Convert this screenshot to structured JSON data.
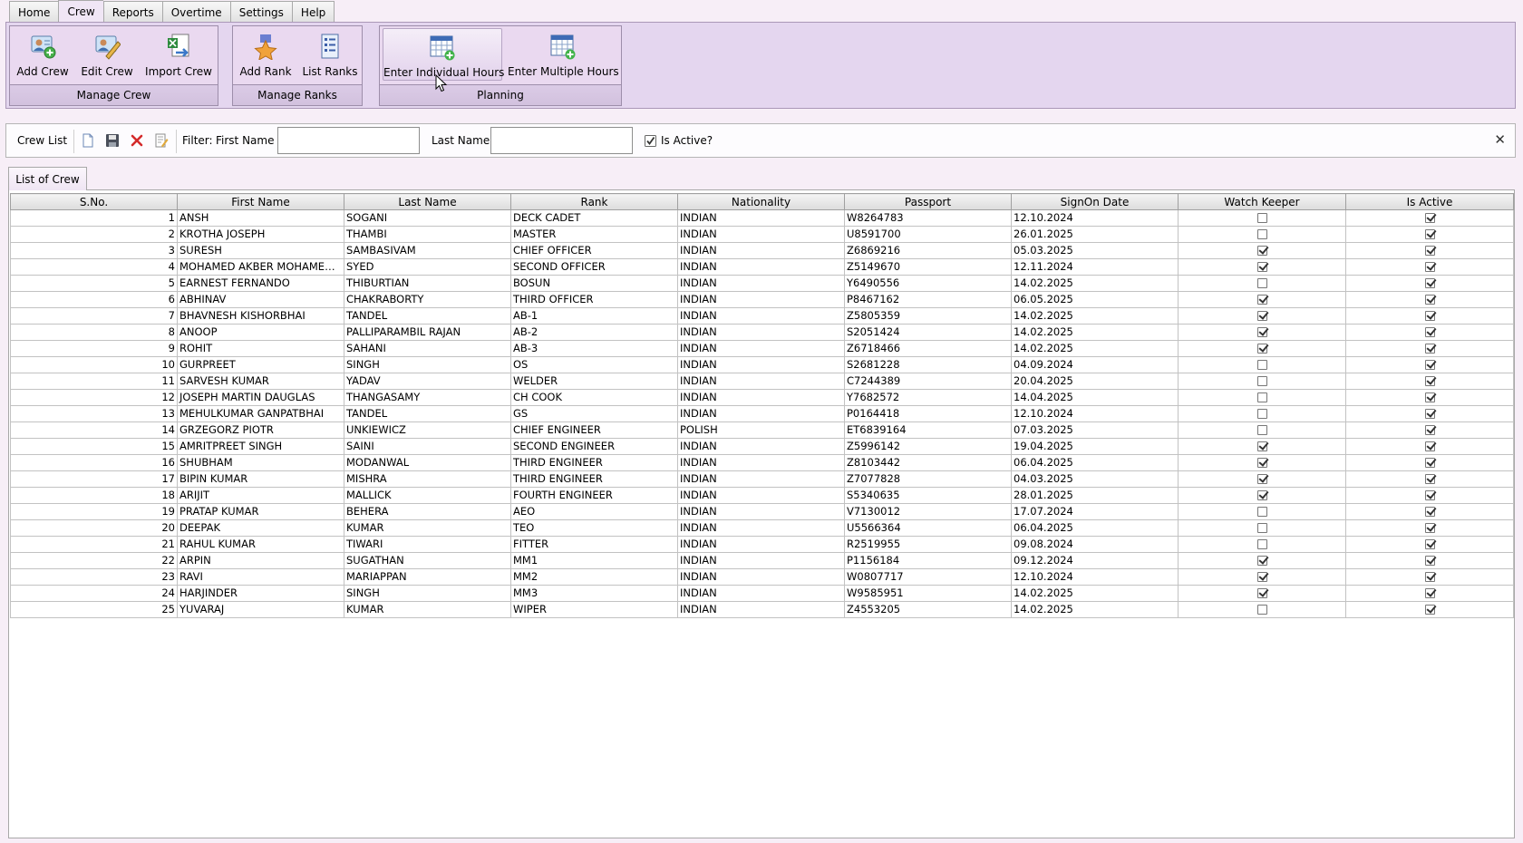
{
  "menu": {
    "tabs": [
      "Home",
      "Crew",
      "Reports",
      "Overtime",
      "Settings",
      "Help"
    ],
    "active": "Crew"
  },
  "ribbon": {
    "manage_crew": {
      "label": "Manage Crew",
      "buttons": [
        "Add Crew",
        "Edit Crew",
        "Import Crew"
      ]
    },
    "manage_ranks": {
      "label": "Manage Ranks",
      "buttons": [
        "Add Rank",
        "List Ranks"
      ]
    },
    "planning": {
      "label": "Planning",
      "buttons": [
        "Enter Individual Hours",
        "Enter Multiple Hours"
      ]
    }
  },
  "toolbar": {
    "title": "Crew List",
    "filter_label": "Filter:",
    "first_name_label": "First Name",
    "first_name_value": "",
    "last_name_label": "Last Name",
    "last_name_value": "",
    "is_active_label": "Is Active?",
    "is_active_checked": true,
    "close_glyph": "✕"
  },
  "list_tab": "List of Crew",
  "grid": {
    "columns": [
      "S.No.",
      "First Name",
      "Last Name",
      "Rank",
      "Nationality",
      "Passport",
      "SignOn Date",
      "Watch Keeper",
      "Is Active"
    ],
    "rows": [
      {
        "sno": "1",
        "first": "ANSH",
        "last": "SOGANI",
        "rank": "DECK CADET",
        "nat": "INDIAN",
        "passport": "W8264783",
        "signon": "12.10.2024",
        "watch": false,
        "active": true
      },
      {
        "sno": "2",
        "first": "KROTHA JOSEPH",
        "last": "THAMBI",
        "rank": "MASTER",
        "nat": "INDIAN",
        "passport": "U8591700",
        "signon": "26.01.2025",
        "watch": false,
        "active": true
      },
      {
        "sno": "3",
        "first": "SURESH",
        "last": "SAMBASIVAM",
        "rank": "CHIEF OFFICER",
        "nat": "INDIAN",
        "passport": "Z6869216",
        "signon": "05.03.2025",
        "watch": true,
        "active": true
      },
      {
        "sno": "4",
        "first": "MOHAMED AKBER MOHAMED AQ...",
        "last": "SYED",
        "rank": "SECOND OFFICER",
        "nat": "INDIAN",
        "passport": "Z5149670",
        "signon": "12.11.2024",
        "watch": true,
        "active": true
      },
      {
        "sno": "5",
        "first": "EARNEST FERNANDO",
        "last": "THIBURTIAN",
        "rank": "BOSUN",
        "nat": "INDIAN",
        "passport": "Y6490556",
        "signon": "14.02.2025",
        "watch": false,
        "active": true
      },
      {
        "sno": "6",
        "first": "ABHINAV",
        "last": "CHAKRABORTY",
        "rank": "THIRD OFFICER",
        "nat": "INDIAN",
        "passport": "P8467162",
        "signon": "06.05.2025",
        "watch": true,
        "active": true
      },
      {
        "sno": "7",
        "first": "BHAVNESH KISHORBHAI",
        "last": "TANDEL",
        "rank": "AB-1",
        "nat": "INDIAN",
        "passport": "Z5805359",
        "signon": "14.02.2025",
        "watch": true,
        "active": true
      },
      {
        "sno": "8",
        "first": "ANOOP",
        "last": "PALLIPARAMBIL RAJAN",
        "rank": "AB-2",
        "nat": "INDIAN",
        "passport": "S2051424",
        "signon": "14.02.2025",
        "watch": true,
        "active": true
      },
      {
        "sno": "9",
        "first": "ROHIT",
        "last": "SAHANI",
        "rank": "AB-3",
        "nat": "INDIAN",
        "passport": "Z6718466",
        "signon": "14.02.2025",
        "watch": true,
        "active": true
      },
      {
        "sno": "10",
        "first": "GURPREET",
        "last": "SINGH",
        "rank": "OS",
        "nat": "INDIAN",
        "passport": "S2681228",
        "signon": "04.09.2024",
        "watch": false,
        "active": true
      },
      {
        "sno": "11",
        "first": "SARVESH KUMAR",
        "last": "YADAV",
        "rank": "WELDER",
        "nat": "INDIAN",
        "passport": "C7244389",
        "signon": "20.04.2025",
        "watch": false,
        "active": true
      },
      {
        "sno": "12",
        "first": "JOSEPH MARTIN DAUGLAS",
        "last": "THANGASAMY",
        "rank": "CH COOK",
        "nat": "INDIAN",
        "passport": "Y7682572",
        "signon": "14.04.2025",
        "watch": false,
        "active": true
      },
      {
        "sno": "13",
        "first": "MEHULKUMAR GANPATBHAI",
        "last": "TANDEL",
        "rank": "GS",
        "nat": "INDIAN",
        "passport": "P0164418",
        "signon": "12.10.2024",
        "watch": false,
        "active": true
      },
      {
        "sno": "14",
        "first": "GRZEGORZ PIOTR",
        "last": "UNKIEWICZ",
        "rank": "CHIEF ENGINEER",
        "nat": "POLISH",
        "passport": "ET6839164",
        "signon": "07.03.2025",
        "watch": false,
        "active": true
      },
      {
        "sno": "15",
        "first": "AMRITPREET SINGH",
        "last": "SAINI",
        "rank": "SECOND ENGINEER",
        "nat": "INDIAN",
        "passport": "Z5996142",
        "signon": "19.04.2025",
        "watch": true,
        "active": true
      },
      {
        "sno": "16",
        "first": "SHUBHAM",
        "last": "MODANWAL",
        "rank": "THIRD ENGINEER",
        "nat": "INDIAN",
        "passport": "Z8103442",
        "signon": "06.04.2025",
        "watch": true,
        "active": true
      },
      {
        "sno": "17",
        "first": "BIPIN KUMAR",
        "last": "MISHRA",
        "rank": "THIRD ENGINEER",
        "nat": "INDIAN",
        "passport": "Z7077828",
        "signon": "04.03.2025",
        "watch": true,
        "active": true
      },
      {
        "sno": "18",
        "first": "ARIJIT",
        "last": "MALLICK",
        "rank": "FOURTH ENGINEER",
        "nat": "INDIAN",
        "passport": "S5340635",
        "signon": "28.01.2025",
        "watch": true,
        "active": true
      },
      {
        "sno": "19",
        "first": "PRATAP KUMAR",
        "last": "BEHERA",
        "rank": "AEO",
        "nat": "INDIAN",
        "passport": "V7130012",
        "signon": "17.07.2024",
        "watch": false,
        "active": true
      },
      {
        "sno": "20",
        "first": "DEEPAK",
        "last": "KUMAR",
        "rank": "TEO",
        "nat": "INDIAN",
        "passport": "U5566364",
        "signon": "06.04.2025",
        "watch": false,
        "active": true
      },
      {
        "sno": "21",
        "first": "RAHUL KUMAR",
        "last": "TIWARI",
        "rank": "FITTER",
        "nat": "INDIAN",
        "passport": "R2519955",
        "signon": "09.08.2024",
        "watch": false,
        "active": true
      },
      {
        "sno": "22",
        "first": "ARPIN",
        "last": "SUGATHAN",
        "rank": "MM1",
        "nat": "INDIAN",
        "passport": "P1156184",
        "signon": "09.12.2024",
        "watch": true,
        "active": true
      },
      {
        "sno": "23",
        "first": "RAVI",
        "last": "MARIAPPAN",
        "rank": "MM2",
        "nat": "INDIAN",
        "passport": "W0807717",
        "signon": "12.10.2024",
        "watch": true,
        "active": true
      },
      {
        "sno": "24",
        "first": "HARJINDER",
        "last": "SINGH",
        "rank": "MM3",
        "nat": "INDIAN",
        "passport": "W9585951",
        "signon": "14.02.2025",
        "watch": true,
        "active": true
      },
      {
        "sno": "25",
        "first": "YUVARAJ",
        "last": "KUMAR",
        "rank": "WIPER",
        "nat": "INDIAN",
        "passport": "Z4553205",
        "signon": "14.02.2025",
        "watch": false,
        "active": true
      }
    ]
  }
}
